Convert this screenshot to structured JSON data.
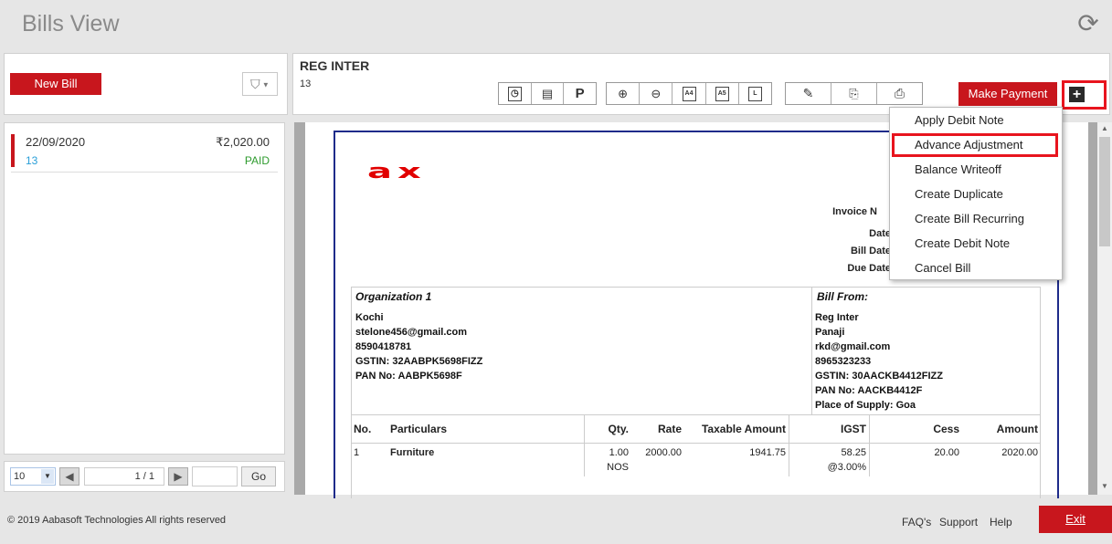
{
  "app": {
    "title": "Bills View"
  },
  "left": {
    "new_bill_label": "New Bill",
    "bill": {
      "date": "22/09/2020",
      "amount": "₹2,020.00",
      "number": "13",
      "status": "PAID"
    },
    "pager": {
      "page_size": "10",
      "page_info": "1 / 1",
      "go_label": "Go"
    }
  },
  "header": {
    "party_name": "REG INTER",
    "bill_no": "13",
    "make_payment_label": "Make Payment"
  },
  "toolbar": {
    "icon_a4": "A4",
    "icon_a5": "A5",
    "icon_l": "L",
    "icon_p": "P"
  },
  "menu": {
    "items": [
      "Apply Debit Note",
      "Advance Adjustment",
      "Balance Writeoff",
      "Create Duplicate",
      "Create Bill Recurring",
      "Create Debit Note",
      "Cancel Bill"
    ]
  },
  "invoice": {
    "logo_text": "ax",
    "labels": {
      "invoice_no": "Invoice N",
      "date": "Date",
      "bill_date": "Bill Date",
      "due_date": "Due Date"
    },
    "org": {
      "title": "Organization 1",
      "lines": [
        "Kochi",
        "stelone456@gmail.com",
        "8590418781",
        "GSTIN: 32AABPK5698FIZZ",
        "PAN No: AABPK5698F"
      ]
    },
    "bill_from": {
      "title": "Bill From:",
      "lines": [
        "Reg Inter",
        "Panaji",
        "rkd@gmail.com",
        "8965323233",
        "GSTIN: 30AACKB4412FIZZ",
        "PAN No: AACKB4412F",
        "Place of Supply: Goa"
      ]
    },
    "table": {
      "headers": [
        "No.",
        "Particulars",
        "Qty.",
        "Rate",
        "Taxable Amount",
        "IGST",
        "Cess",
        "Amount"
      ],
      "row": {
        "no": "1",
        "particulars": "Furniture",
        "qty": "1.00",
        "unit": "NOS",
        "rate": "2000.00",
        "taxable": "1941.75",
        "igst": "58.25",
        "igst_rate": "@3.00%",
        "cess": "20.00",
        "amount": "2020.00"
      }
    }
  },
  "footer": {
    "copyright": "© 2019 Aabasoft Technologies All rights reserved",
    "faqs": "FAQ's",
    "support": "Support",
    "help": "Help",
    "exit": "Exit"
  },
  "colors": {
    "brand_red": "#c8161d",
    "highlight_red": "#e8141e",
    "doc_border": "#1e2b8a",
    "paid_green": "#2e9b2e",
    "link_blue": "#2a9fd8"
  }
}
